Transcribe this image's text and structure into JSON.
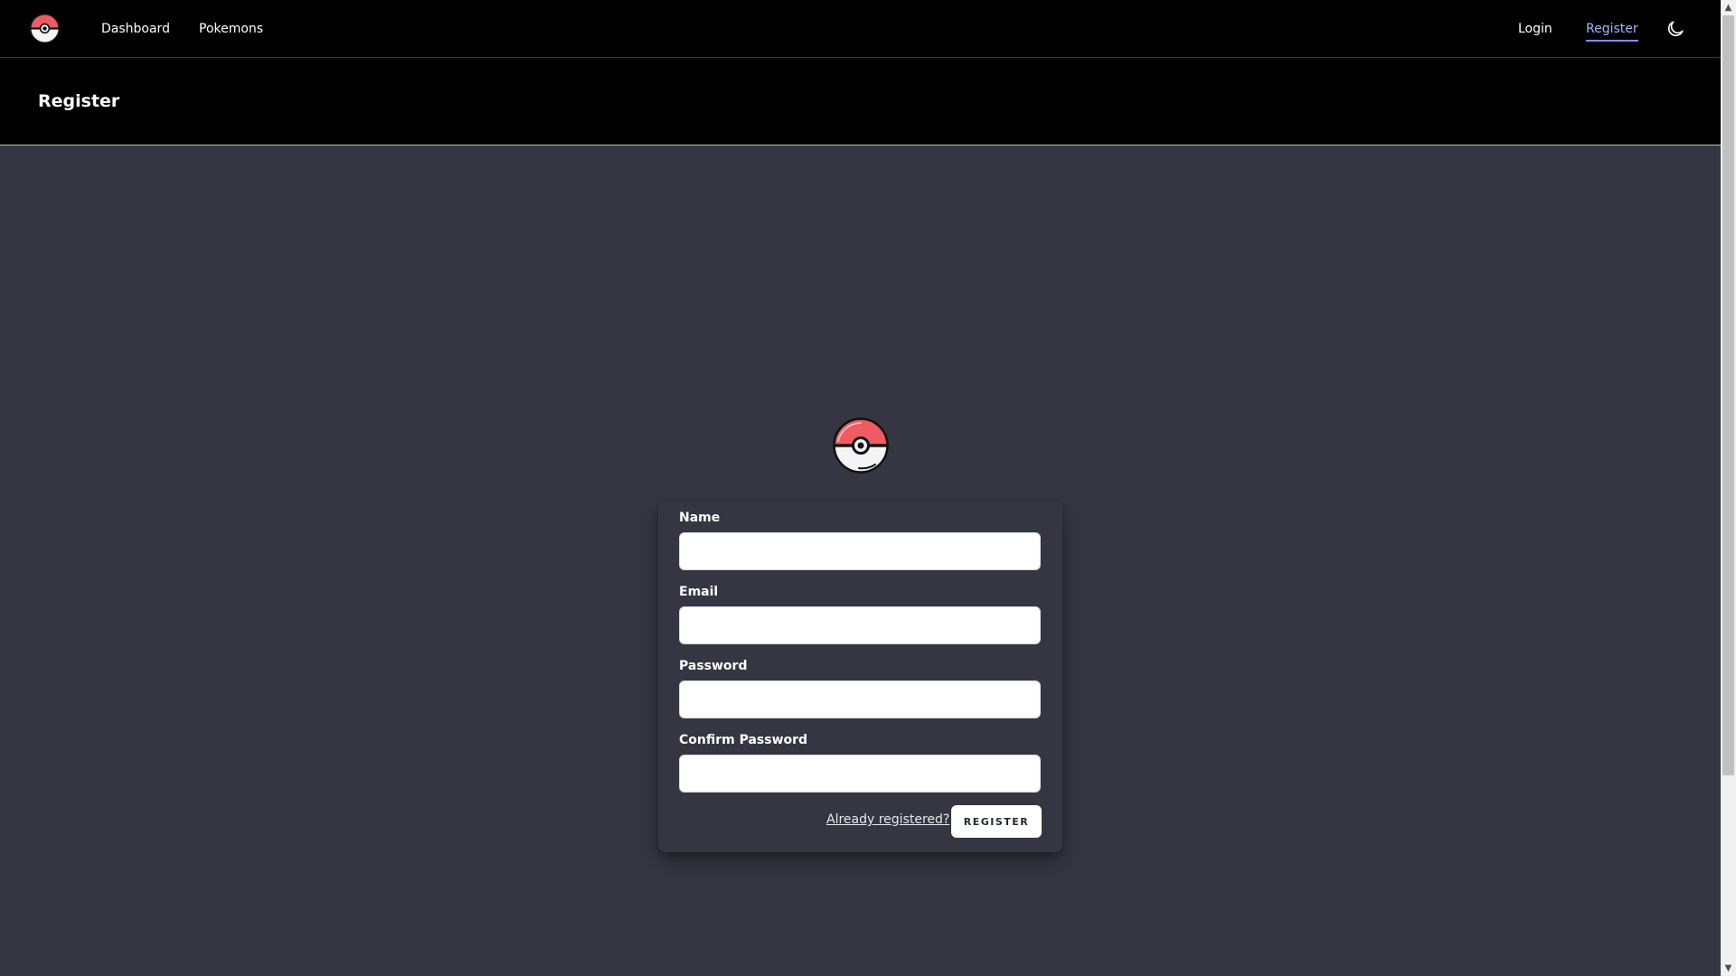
{
  "nav": {
    "logo_icon": "pokeball-icon",
    "links": [
      {
        "label": "Dashboard"
      },
      {
        "label": "Pokemons"
      }
    ],
    "auth_links": [
      {
        "label": "Login"
      },
      {
        "label": "Register",
        "active": true
      }
    ],
    "theme_toggle_icon": "moon-icon"
  },
  "header": {
    "title": "Register"
  },
  "form": {
    "logo_icon": "pokeball-icon",
    "fields": [
      {
        "label": "Name",
        "value": ""
      },
      {
        "label": "Email",
        "value": ""
      },
      {
        "label": "Password",
        "value": ""
      },
      {
        "label": "Confirm Password",
        "value": ""
      }
    ],
    "already_registered_link": "Already registered?",
    "submit_label": "REGISTER"
  },
  "colors": {
    "page_background": "#363642",
    "nav_background": "#000000",
    "active_link": "#a5b4fc",
    "pokeball_red": "#ee5b63"
  }
}
